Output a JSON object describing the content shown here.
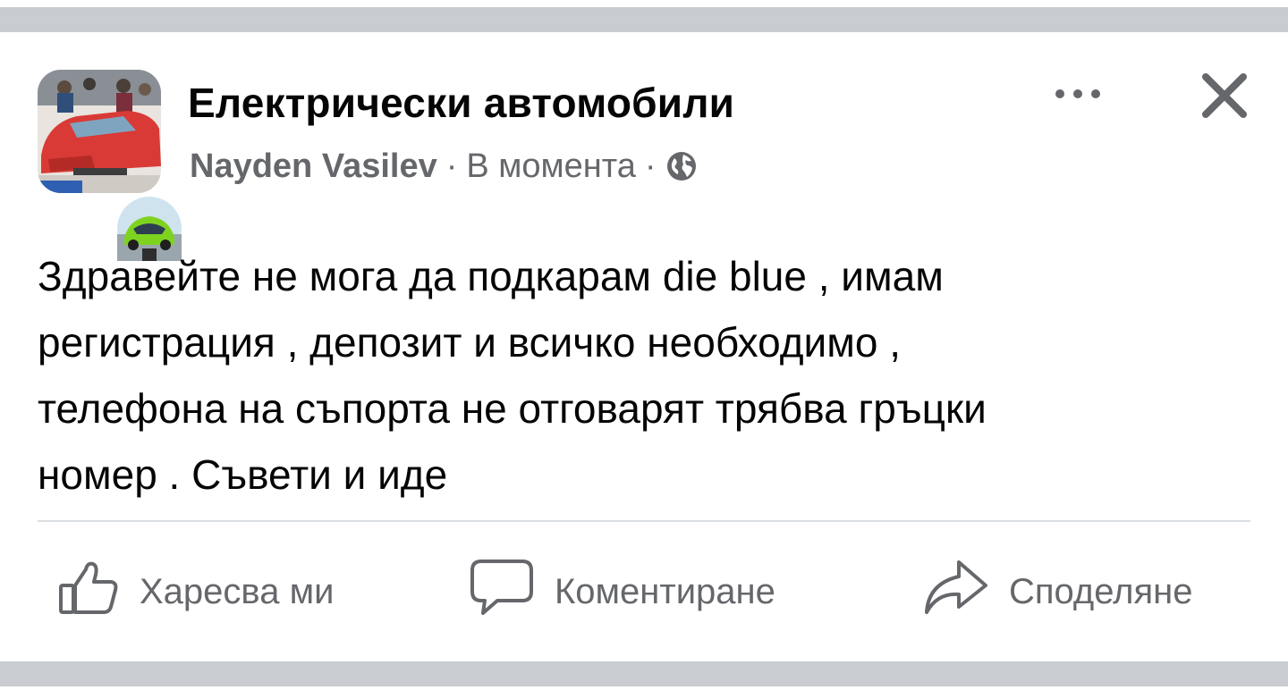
{
  "post": {
    "group_name": "Електрически автомобили",
    "author": "Nayden Vasilev",
    "separator": "·",
    "timestamp": "В момента",
    "privacy_icon": "globe-icon",
    "body_lines": [
      "Здравейте не мога да подкарам die blue , имам",
      "регистрация , депозит и всичко необходимо ,",
      "телефона на съпорта не отговарят трябва гръцки",
      "номер . Съвети и иде"
    ]
  },
  "header_actions": {
    "more_icon": "more-options-icon",
    "close_icon": "close-icon"
  },
  "actions": {
    "like_label": "Харесва ми",
    "comment_label": "Коментиране",
    "share_label": "Споделяне"
  },
  "colors": {
    "band": "#c9ccd1",
    "text_primary": "#050505",
    "text_secondary": "#65676b",
    "divider": "#dadde1"
  }
}
